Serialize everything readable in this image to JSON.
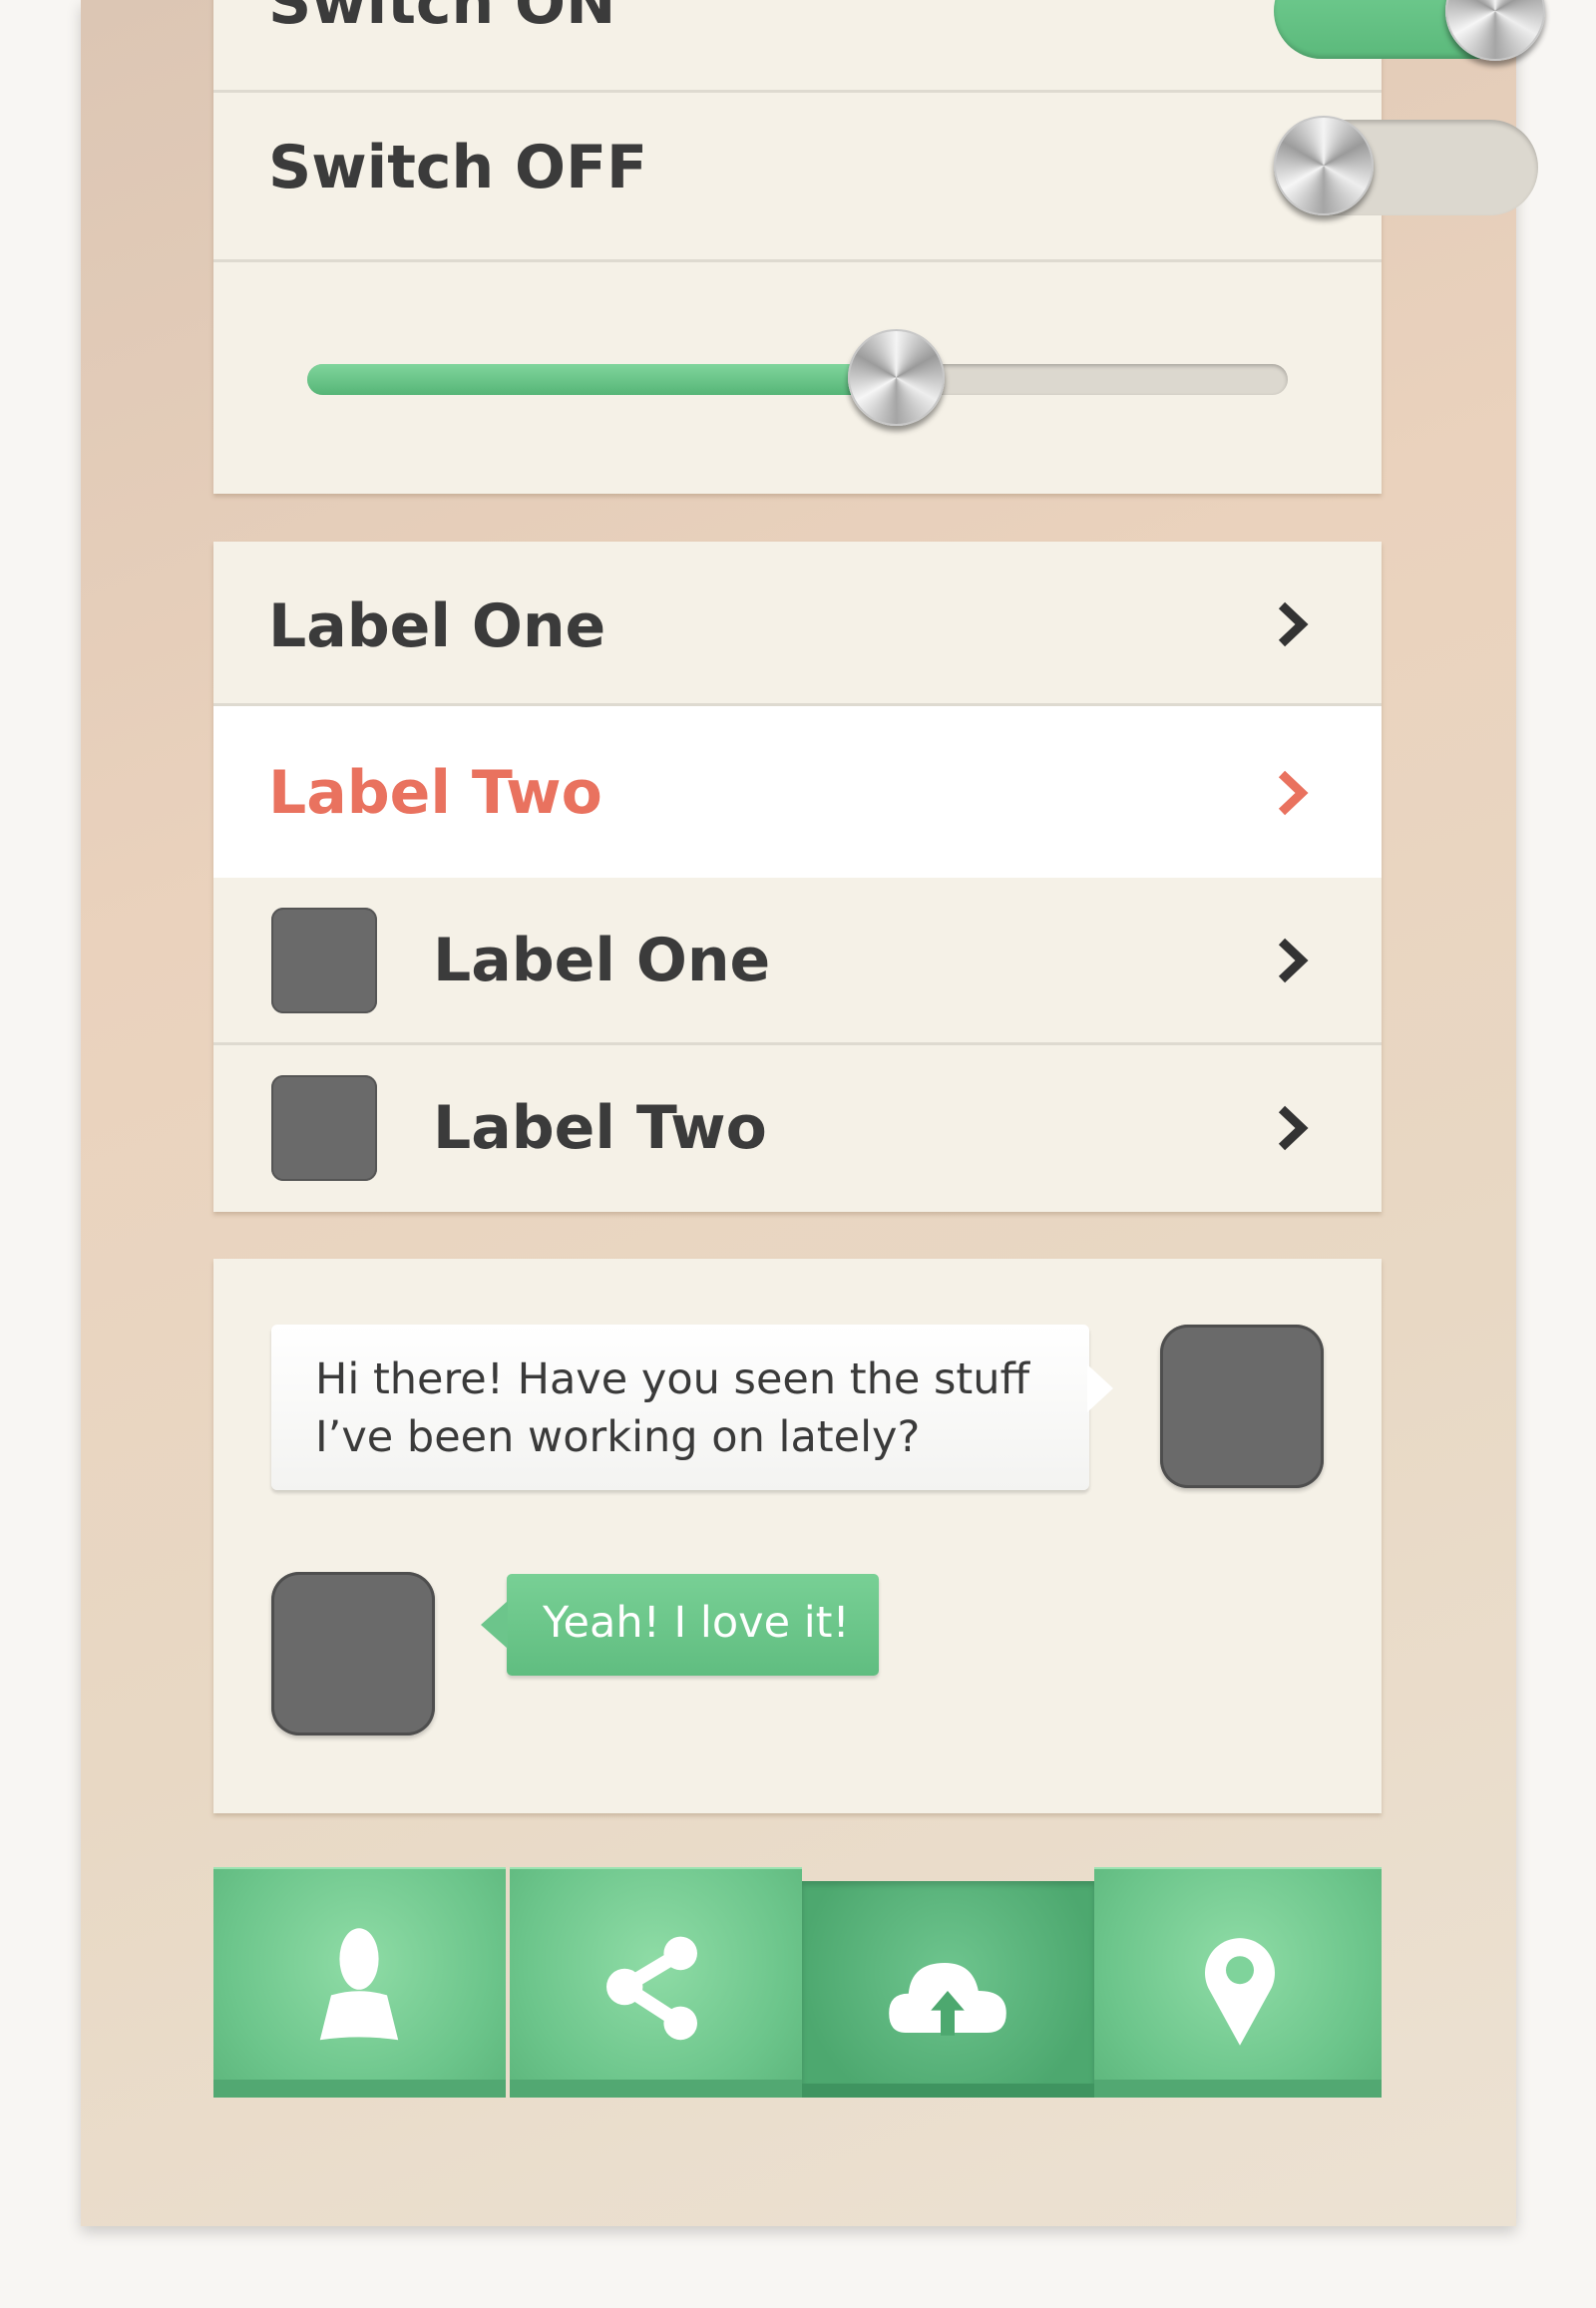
{
  "colors": {
    "accent_green": "#6cc58b",
    "highlight_red": "#e9725f",
    "card": "#f5f1e7",
    "text": "#3b3b3b"
  },
  "switches": [
    {
      "label": "Switch ON",
      "state": "on"
    },
    {
      "label": "Switch OFF",
      "state": "off"
    }
  ],
  "slider": {
    "value_fraction": 0.6
  },
  "list": [
    {
      "label": "Label One",
      "selected": false,
      "icon": "chevron-right-icon"
    },
    {
      "label": "Label Two",
      "selected": true,
      "icon": "chevron-right-icon"
    },
    {
      "label": "Label One",
      "selected": false,
      "thumbnail": true,
      "icon": "chevron-right-icon"
    },
    {
      "label": "Label Two",
      "selected": false,
      "thumbnail": true,
      "icon": "chevron-right-icon"
    }
  ],
  "chat": {
    "incoming": {
      "line1": "Hi there! Have you seen the stuff",
      "line2": "I’ve been working on lately?"
    },
    "outgoing": {
      "text": "Yeah! I love it!"
    }
  },
  "tabbar": [
    {
      "icon": "user-icon",
      "active": false
    },
    {
      "icon": "share-icon",
      "active": false
    },
    {
      "icon": "cloud-upload-icon",
      "active": true
    },
    {
      "icon": "location-pin-icon",
      "active": false
    }
  ]
}
